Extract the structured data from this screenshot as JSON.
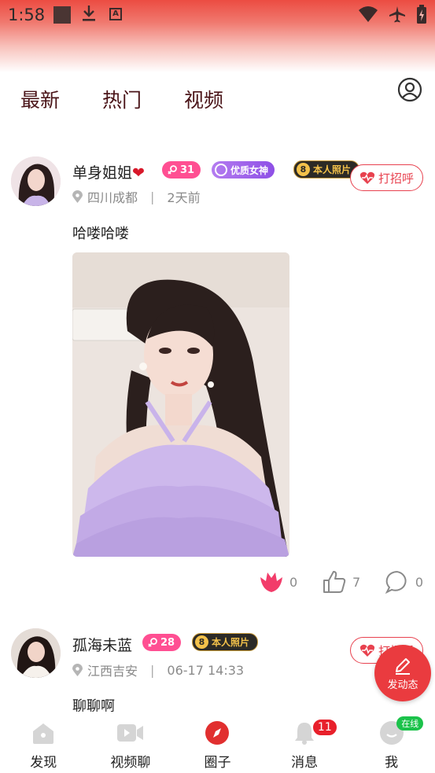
{
  "status_bar": {
    "time": "1:58"
  },
  "tabs": [
    {
      "label": "最新"
    },
    {
      "label": "热门"
    },
    {
      "label": "视频"
    }
  ],
  "posts": [
    {
      "username": "单身姐姐",
      "heart": "❤",
      "level": "31",
      "goddess_badge": "优质女神",
      "photo_badge": "本人照片",
      "location": "四川成都",
      "time": "2天前",
      "greet": "打招呼",
      "content": "哈喽哈喽",
      "likes": "0",
      "thumbs": "7",
      "comments": "0"
    },
    {
      "username": "孤海未蓝",
      "level": "28",
      "photo_badge": "本人照片",
      "location": "江西吉安",
      "time": "06-17 14:33",
      "greet": "打招呼",
      "content": "聊聊啊"
    }
  ],
  "fab": {
    "label": "发动态"
  },
  "bottom_nav": [
    {
      "label": "发现"
    },
    {
      "label": "视频聊"
    },
    {
      "label": "圈子"
    },
    {
      "label": "消息",
      "badge": "11"
    },
    {
      "label": "我",
      "status": "在线"
    }
  ],
  "colors": {
    "accent": "#e8424f",
    "fab": "#ea3b3f",
    "tab_text": "#4a1418",
    "level_badge": "#ff4f92",
    "online": "#1bc24a"
  }
}
